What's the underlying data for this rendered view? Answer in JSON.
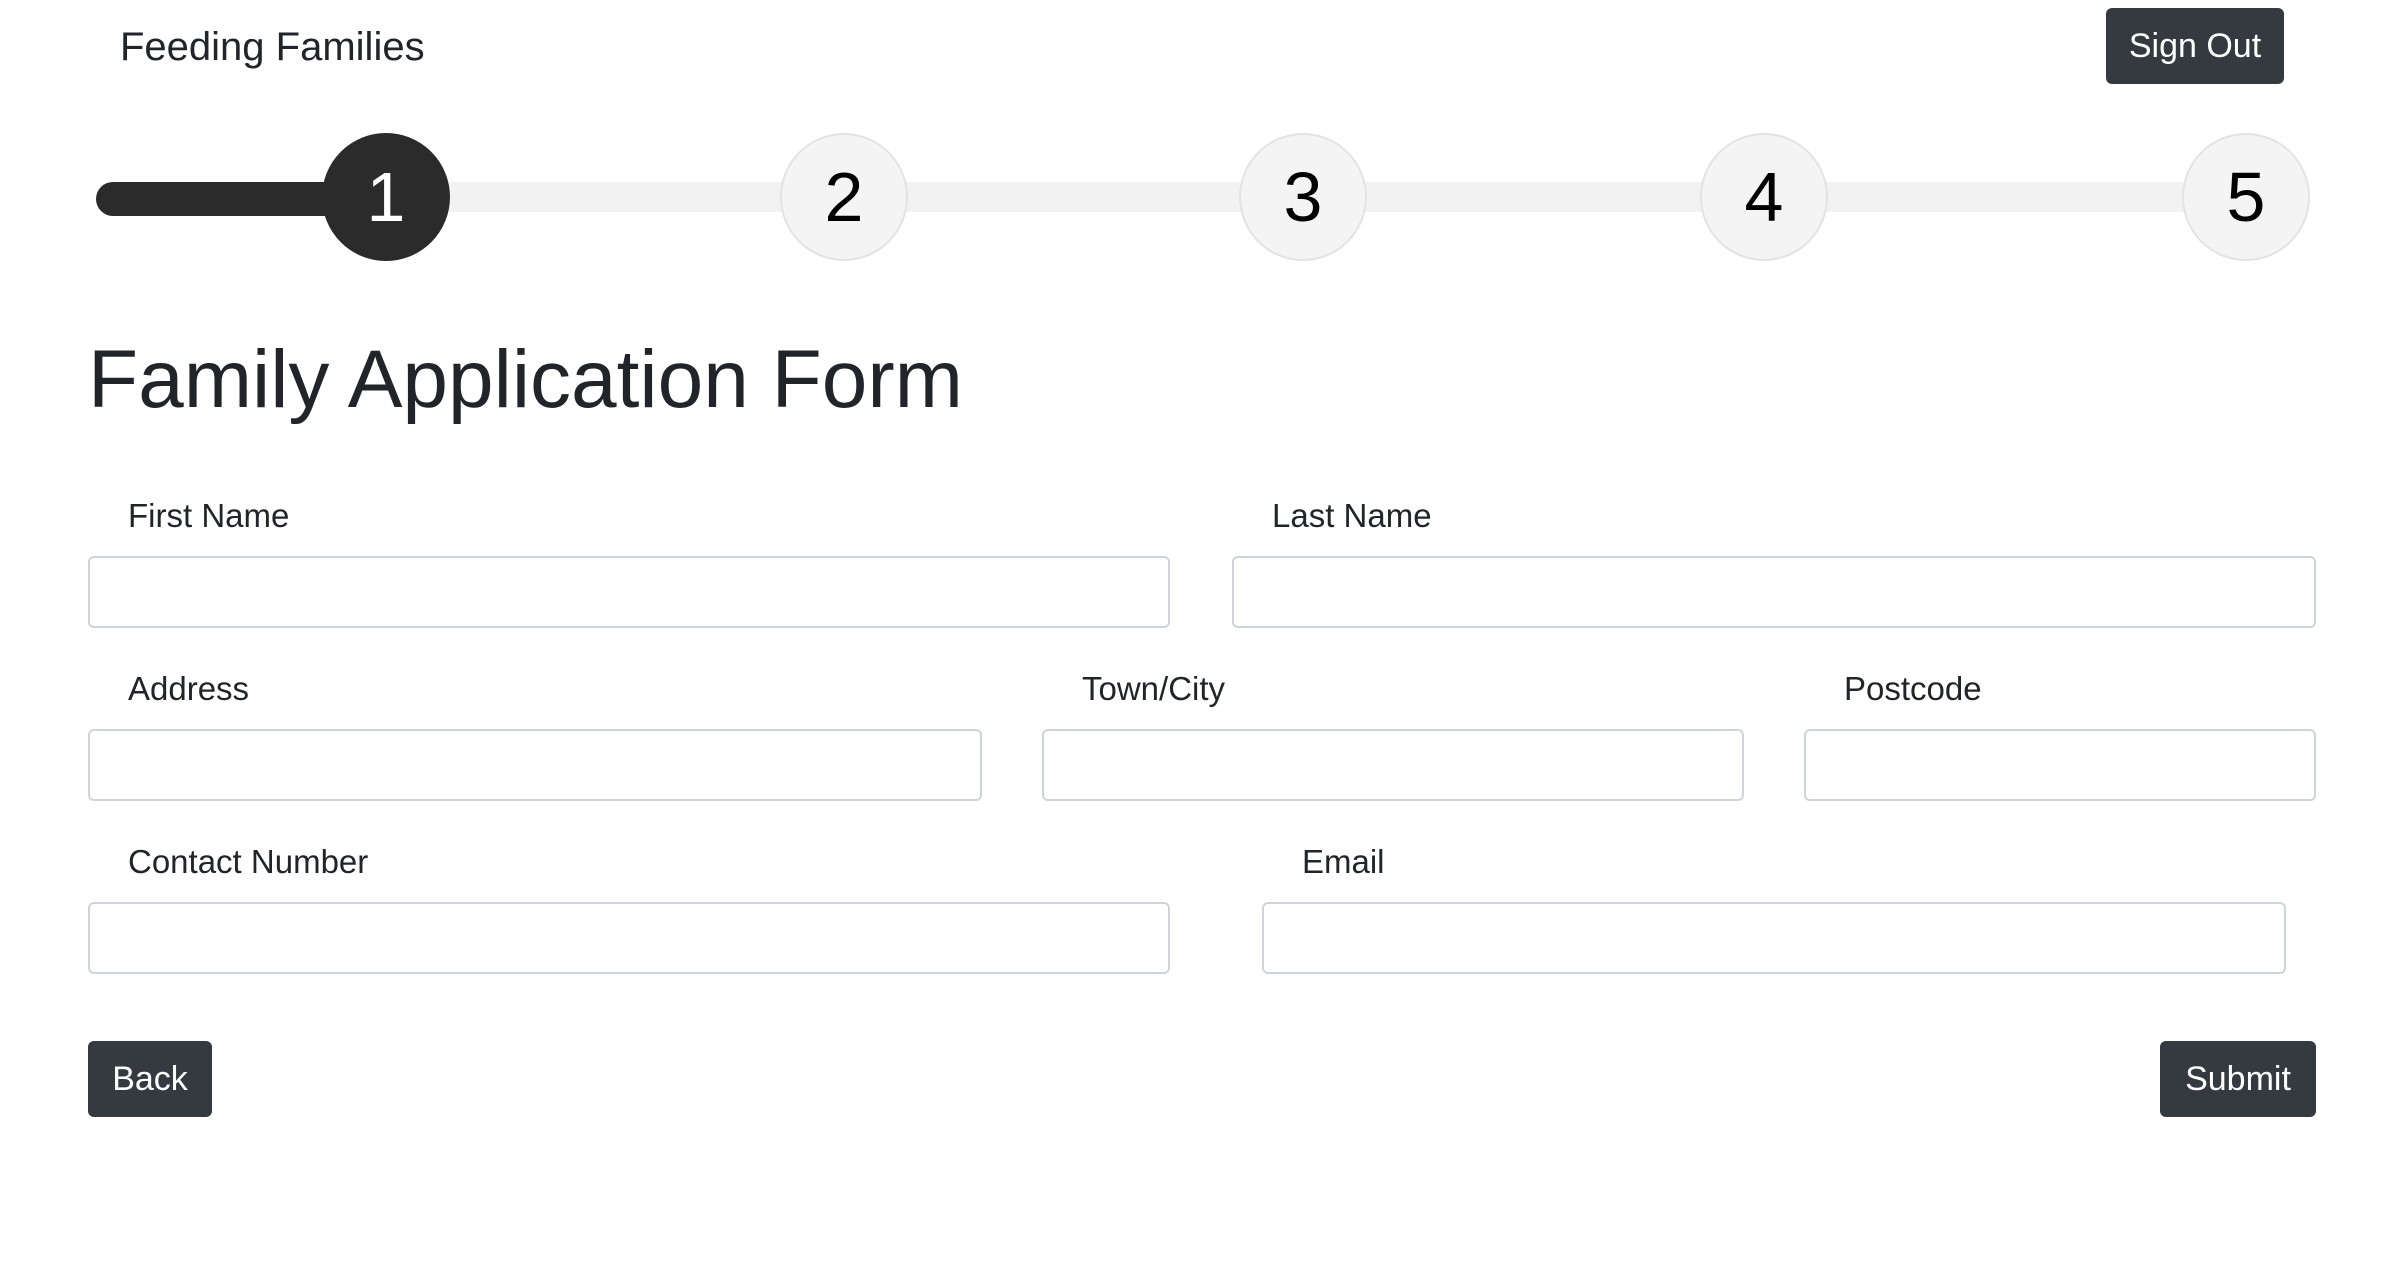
{
  "header": {
    "brand": "Feeding Families",
    "sign_out_label": "Sign Out"
  },
  "progress": {
    "current_step": 1,
    "steps": [
      "1",
      "2",
      "3",
      "4",
      "5"
    ]
  },
  "page": {
    "title": "Family Application Form"
  },
  "form": {
    "first_name": {
      "label": "First Name",
      "value": "",
      "placeholder": ""
    },
    "last_name": {
      "label": "Last Name",
      "value": "",
      "placeholder": ""
    },
    "address": {
      "label": "Address",
      "value": "",
      "placeholder": ""
    },
    "town_city": {
      "label": "Town/City",
      "value": "",
      "placeholder": ""
    },
    "postcode": {
      "label": "Postcode",
      "value": "",
      "placeholder": ""
    },
    "contact_number": {
      "label": "Contact Number",
      "value": "",
      "placeholder": ""
    },
    "email": {
      "label": "Email",
      "value": "",
      "placeholder": ""
    }
  },
  "actions": {
    "back_label": "Back",
    "submit_label": "Submit"
  },
  "colors": {
    "button_bg": "#343a40",
    "active_step": "#2b2b2b",
    "inactive_step": "#f4f4f4"
  }
}
